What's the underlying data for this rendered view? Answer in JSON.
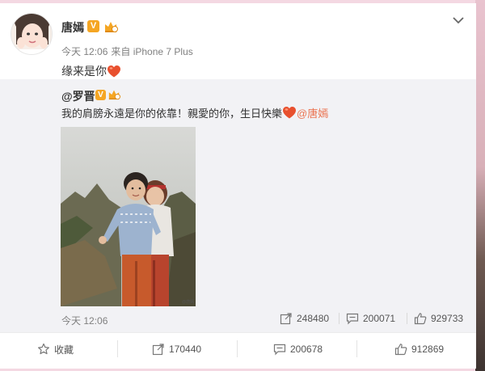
{
  "post": {
    "username": "唐嫣",
    "verified_badge": "V",
    "meta_time": "今天 12:06",
    "meta_source": "来自 iPhone 7 Plus",
    "text": "缘来是你"
  },
  "repost": {
    "username": "@罗晋",
    "verified_badge": "V",
    "text": "我的肩膀永遠是你的依靠！親愛的你，生日快樂",
    "mention": "@唐嫣",
    "time": "今天 12:06",
    "stats": {
      "share_count": "248480",
      "comment_count": "200071",
      "like_count": "929733"
    }
  },
  "actions": {
    "favorite_label": "收藏",
    "share_count": "170440",
    "comment_count": "200678",
    "like_count": "912869"
  },
  "colors": {
    "mention": "#eb7350",
    "heart": "#e8502e",
    "badge": "#f5a623",
    "repost_bg": "#f2f2f5"
  }
}
